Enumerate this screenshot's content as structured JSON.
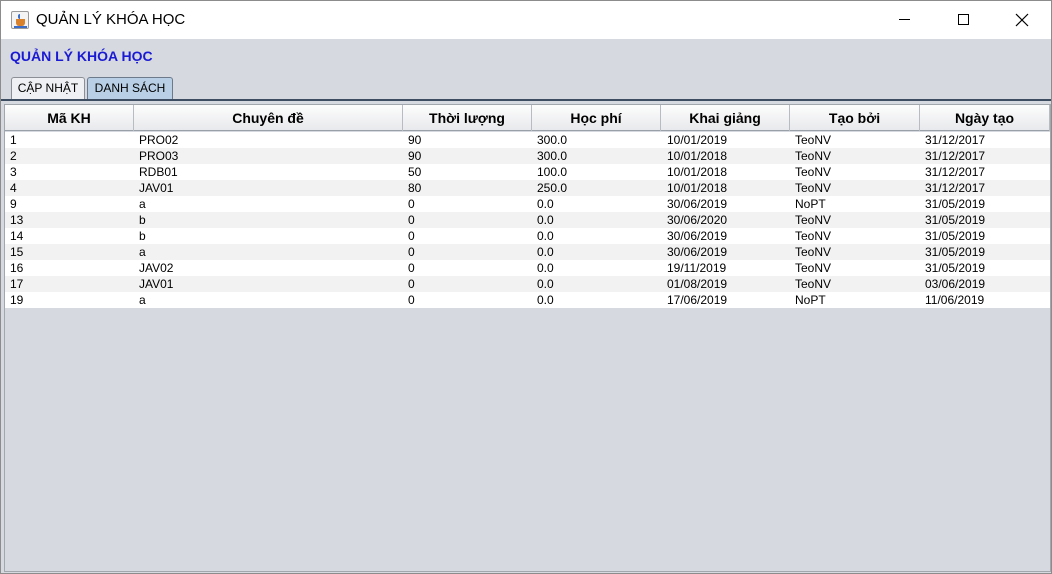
{
  "window": {
    "title": "QUẢN LÝ KHÓA HỌC",
    "app_icon": "java-cup-icon"
  },
  "heading": "QUẢN LÝ KHÓA HỌC",
  "tabs": [
    {
      "label": "CẬP NHẬT",
      "selected": false
    },
    {
      "label": "DANH SÁCH",
      "selected": true
    }
  ],
  "table": {
    "columns": [
      "Mã KH",
      "Chuyên đề",
      "Thời lượng",
      "Học phí",
      "Khai giảng",
      "Tạo bởi",
      "Ngày tạo"
    ],
    "rows": [
      [
        "1",
        "PRO02",
        "90",
        "300.0",
        "10/01/2019",
        "TeoNV",
        "31/12/2017"
      ],
      [
        "2",
        "PRO03",
        "90",
        "300.0",
        "10/01/2018",
        "TeoNV",
        "31/12/2017"
      ],
      [
        "3",
        "RDB01",
        "50",
        "100.0",
        "10/01/2018",
        "TeoNV",
        "31/12/2017"
      ],
      [
        "4",
        "JAV01",
        "80",
        "250.0",
        "10/01/2018",
        "TeoNV",
        "31/12/2017"
      ],
      [
        "9",
        "a",
        "0",
        "0.0",
        "30/06/2019",
        "NoPT",
        "31/05/2019"
      ],
      [
        "13",
        "b",
        "0",
        "0.0",
        "30/06/2020",
        "TeoNV",
        "31/05/2019"
      ],
      [
        "14",
        "b",
        "0",
        "0.0",
        "30/06/2019",
        "TeoNV",
        "31/05/2019"
      ],
      [
        "15",
        "a",
        "0",
        "0.0",
        "30/06/2019",
        "TeoNV",
        "31/05/2019"
      ],
      [
        "16",
        "JAV02",
        "0",
        "0.0",
        "19/11/2019",
        "TeoNV",
        "31/05/2019"
      ],
      [
        "17",
        "JAV01",
        "0",
        "0.0",
        "01/08/2019",
        "TeoNV",
        "03/06/2019"
      ],
      [
        "19",
        "a",
        "0",
        "0.0",
        "17/06/2019",
        "NoPT",
        "11/06/2019"
      ]
    ]
  },
  "colors": {
    "heading": "#1a1ad4",
    "selected_tab": "#b8cfe5",
    "panel_bg": "#d6d9df"
  }
}
